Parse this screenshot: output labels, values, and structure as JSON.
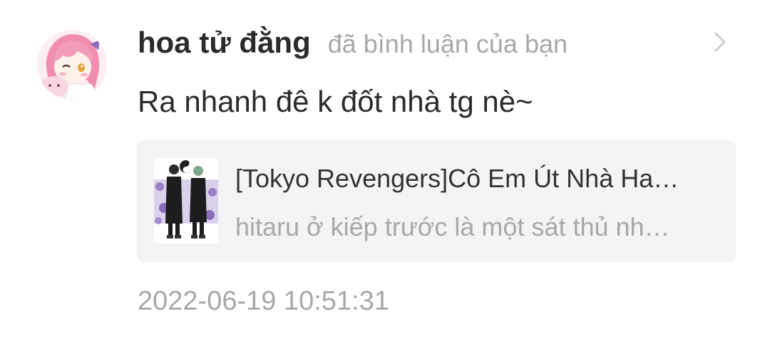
{
  "notification": {
    "avatar_icon": "user-avatar-anime-girl-pink-hair",
    "username": "hoa tử đằng",
    "action_text": "đã bình luận của bạn",
    "chevron_icon": "chevron-right-icon",
    "comment_text": "Ra nhanh đê k đốt nhà tg nè~",
    "story": {
      "cover_icon": "book-cover-two-characters-in-black-coats",
      "title": "[Tokyo Revengers]Cô Em Út Nhà Ha…",
      "description": "hitaru ở kiếp trước là một sát thủ nh…"
    },
    "timestamp": "2022-06-19 10:51:31"
  },
  "colors": {
    "primary_text": "#2b2b2b",
    "secondary_text": "#a8a8a8",
    "card_background": "#f4f4f6",
    "chevron": "#d0d0d0"
  }
}
